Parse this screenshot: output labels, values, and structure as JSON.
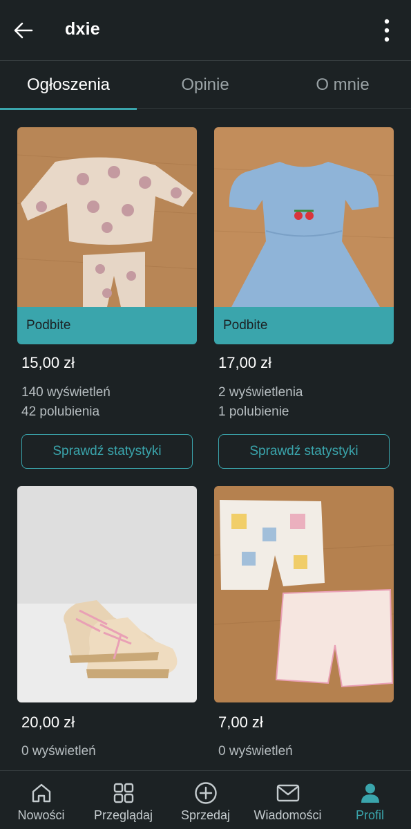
{
  "header": {
    "username": "dxie"
  },
  "tabs": [
    {
      "label": "Ogłoszenia",
      "active": true
    },
    {
      "label": "Opinie",
      "active": false
    },
    {
      "label": "O mnie",
      "active": false
    }
  ],
  "listings": [
    {
      "badge": "Podbite",
      "price": "15,00 zł",
      "views": "140 wyświetleń",
      "likes": "42 polubienia",
      "button": "Sprawdź statystyki"
    },
    {
      "badge": "Podbite",
      "price": "17,00 zł",
      "views": "2 wyświetlenia",
      "likes": "1 polubienie",
      "button": "Sprawdź statystyki"
    },
    {
      "price": "20,00 zł",
      "views": "0 wyświetleń"
    },
    {
      "price": "7,00 zł",
      "views": "0 wyświetleń"
    }
  ],
  "bottom_nav": [
    {
      "label": "Nowości",
      "icon": "home-icon",
      "active": false
    },
    {
      "label": "Przeglądaj",
      "icon": "grid-icon",
      "active": false
    },
    {
      "label": "Sprzedaj",
      "icon": "plus-circle-icon",
      "active": false
    },
    {
      "label": "Wiadomości",
      "icon": "mail-icon",
      "active": false
    },
    {
      "label": "Profil",
      "icon": "user-icon",
      "active": true
    }
  ],
  "colors": {
    "background": "#1c2224",
    "accent": "#3aa5ac",
    "text": "#ffffff",
    "muted": "#b7bec1"
  }
}
